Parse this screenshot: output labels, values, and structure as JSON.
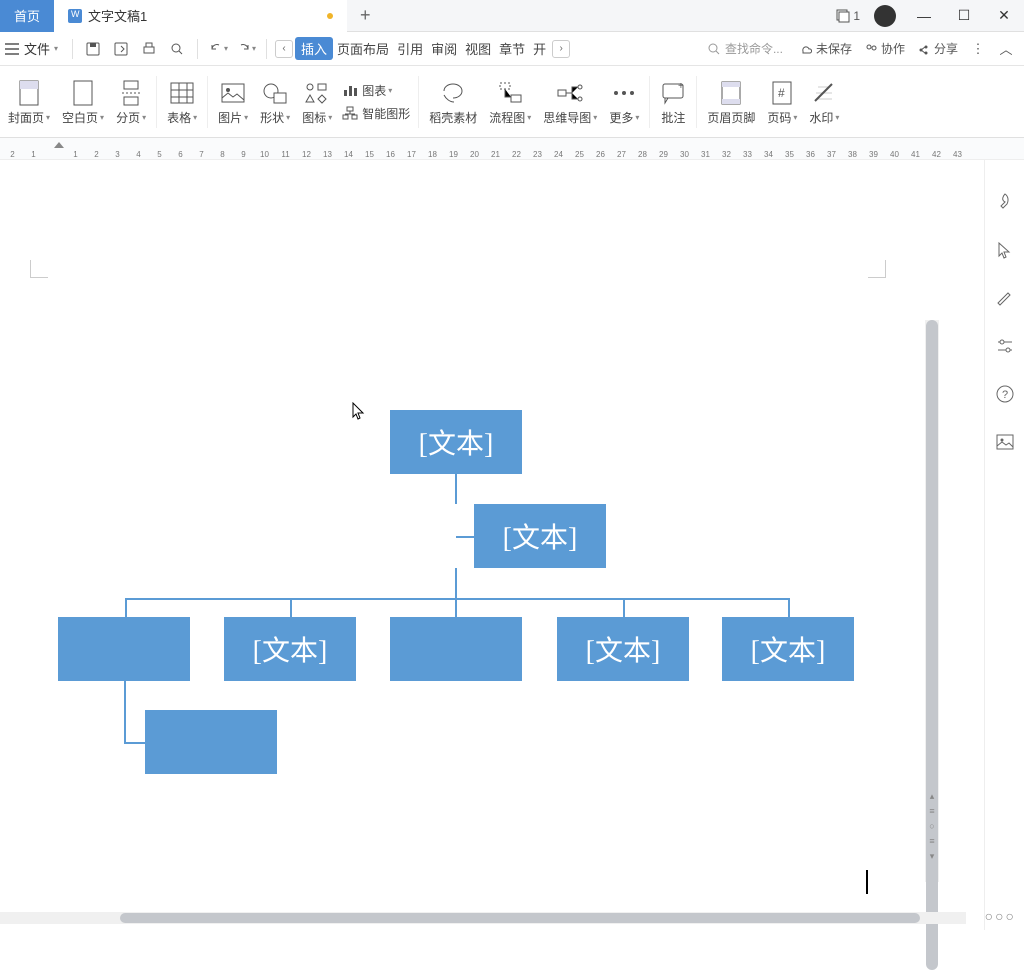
{
  "tabs": {
    "home": "首页",
    "doc": "文字文稿1",
    "add": "+"
  },
  "window": {
    "badge_count": "1"
  },
  "menu": {
    "file": "文件",
    "ribbon_tabs": [
      "插入",
      "页面布局",
      "引用",
      "审阅",
      "视图",
      "章节",
      "开"
    ],
    "search_placeholder": "查找命令...",
    "unsaved": "未保存",
    "collab": "协作",
    "share": "分享"
  },
  "ribbon": {
    "cover": "封面页",
    "blank": "空白页",
    "pagebreak": "分页",
    "table": "表格",
    "picture": "图片",
    "shape": "形状",
    "icon": "图标",
    "chart": "图表",
    "smartart": "智能图形",
    "wps_gallery": "稻壳素材",
    "flowchart": "流程图",
    "mindmap": "思维导图",
    "more": "更多",
    "comment": "批注",
    "headerfooter": "页眉页脚",
    "pagenum": "页码",
    "watermark": "水印"
  },
  "ruler_nums": [
    "2",
    "1",
    "",
    "1",
    "2",
    "3",
    "4",
    "5",
    "6",
    "7",
    "8",
    "9",
    "10",
    "11",
    "12",
    "13",
    "14",
    "15",
    "16",
    "17",
    "18",
    "19",
    "20",
    "21",
    "22",
    "23",
    "24",
    "25",
    "26",
    "27",
    "28",
    "29",
    "30",
    "31",
    "32",
    "33",
    "34",
    "35",
    "36",
    "37",
    "38",
    "39",
    "40",
    "41",
    "42",
    "43"
  ],
  "diagram": {
    "node1": "[文本]",
    "node2": "[文本]",
    "leaf1": "",
    "leaf2": "[文本]",
    "leaf3": "",
    "leaf4": "[文本]",
    "leaf5": "[文本]",
    "sub1": ""
  }
}
